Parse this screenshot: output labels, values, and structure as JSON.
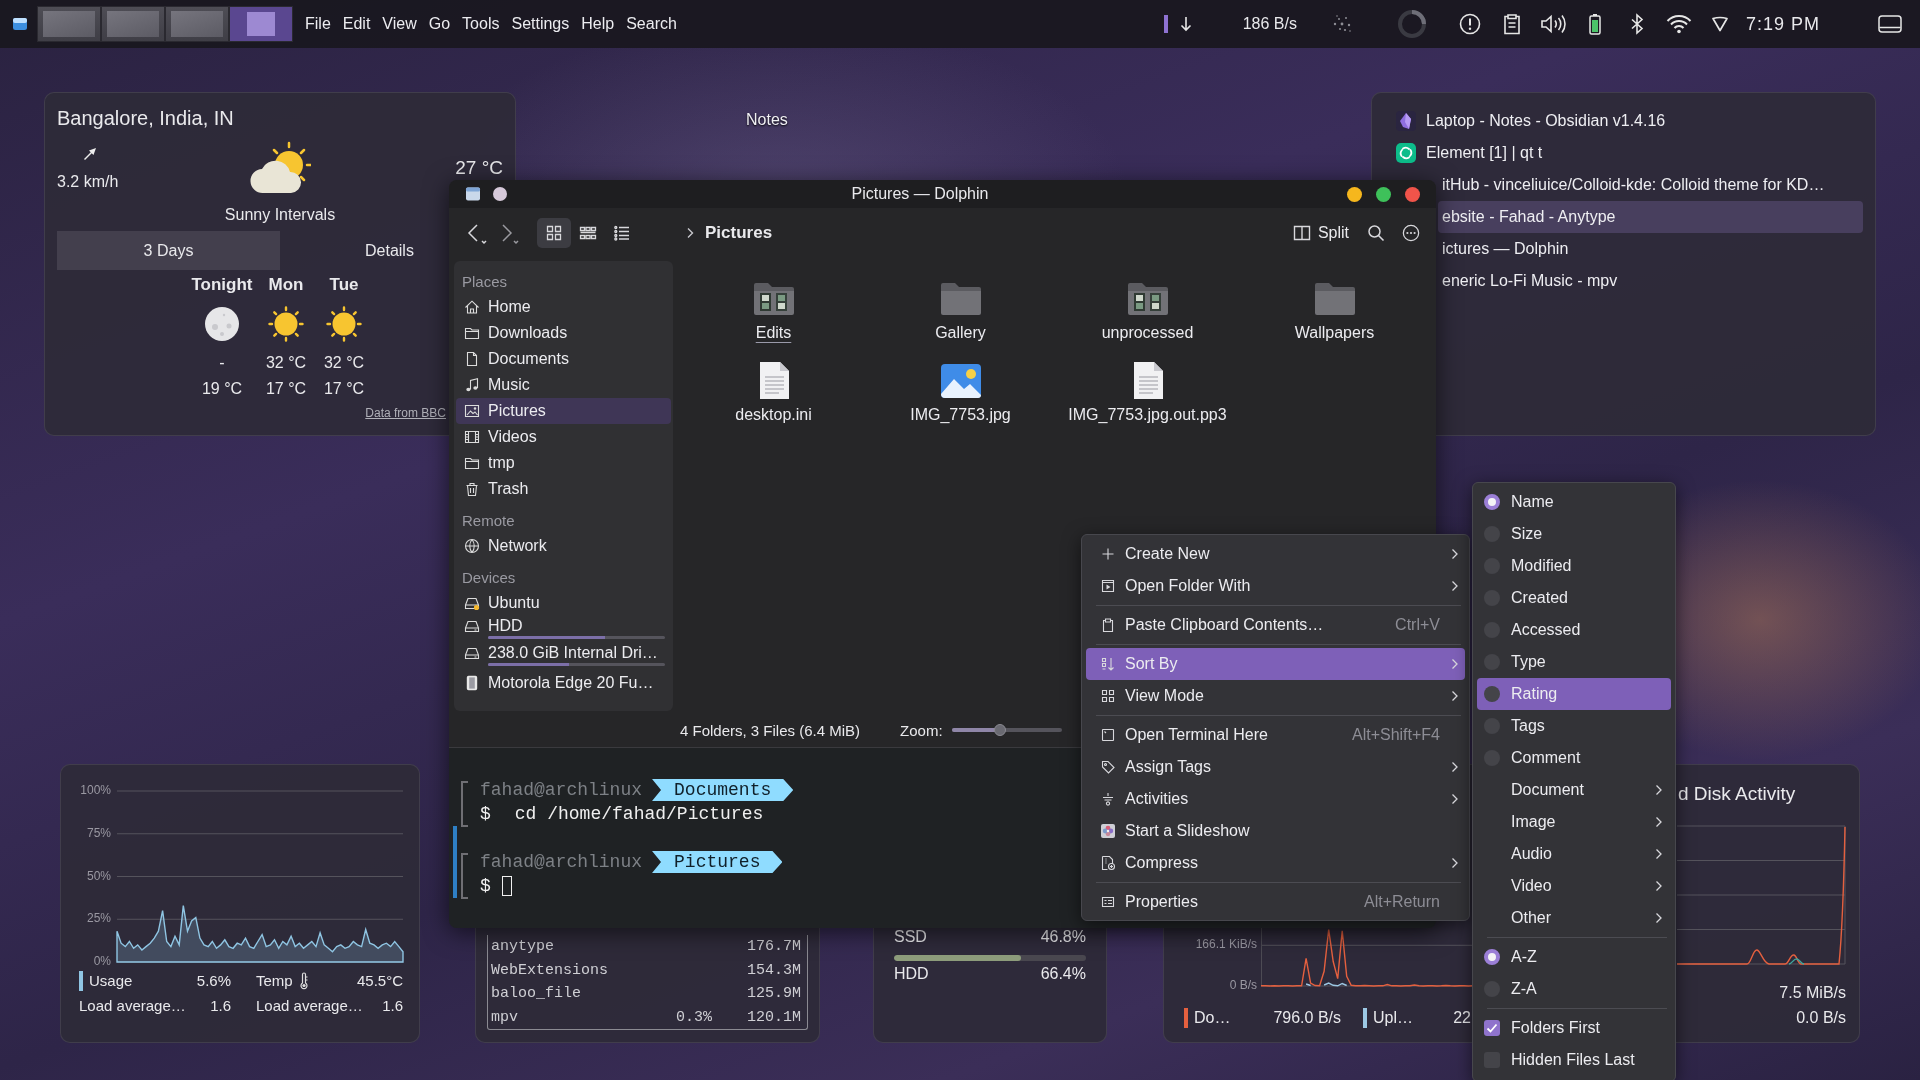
{
  "panel": {
    "pager": [
      {
        "selected": false
      },
      {
        "selected": false
      },
      {
        "selected": false
      },
      {
        "selected": true
      }
    ],
    "menu": [
      "File",
      "Edit",
      "View",
      "Go",
      "Tools",
      "Settings",
      "Help",
      "Search"
    ],
    "net_speed": "186 B/s",
    "clock": "7:19 PM"
  },
  "desktop_icons": [
    {
      "label": "Notes"
    }
  ],
  "weather": {
    "location": "Bangalore, India, IN",
    "wind": "3.2 km/h",
    "temperature": "27 °C",
    "condition": "Sunny Intervals",
    "tabs": [
      {
        "label": "3 Days",
        "selected": true
      },
      {
        "label": "Details",
        "selected": false
      }
    ],
    "forecast": [
      {
        "day": "Tonight",
        "kind": "night",
        "high": "-",
        "low": "19 °C"
      },
      {
        "day": "Mon",
        "kind": "day",
        "high": "32 °C",
        "low": "17 °C"
      },
      {
        "day": "Tue",
        "kind": "day",
        "high": "32 °C",
        "low": "17 °C"
      }
    ],
    "source": "Data from BBC"
  },
  "window_list": [
    {
      "title": "Laptop - Notes - Obsidian v1.4.16",
      "kind": "visible",
      "selected": false
    },
    {
      "title": "Element [1] | qt t",
      "kind": "visible",
      "selected": false
    },
    {
      "title": "itHub - vinceliuice/Colloid-kde: Colloid theme for KD…",
      "kind": "covered",
      "selected": false
    },
    {
      "title": "ebsite - Fahad - Anytype",
      "kind": "covered",
      "selected": true
    },
    {
      "title": "ictures — Dolphin",
      "kind": "covered",
      "selected": false
    },
    {
      "title": "eneric Lo-Fi Music - mpv",
      "kind": "covered",
      "selected": false
    }
  ],
  "dolphin": {
    "title": "Pictures — Dolphin",
    "view_modes": [
      {
        "selected": true
      },
      {
        "selected": false
      },
      {
        "selected": false
      }
    ],
    "breadcrumb": "Pictures",
    "split": "Split",
    "places": [
      {
        "heading": "Places",
        "items": [
          {
            "label": "Home",
            "kind": "home",
            "selected": false
          },
          {
            "label": "Downloads",
            "kind": "folder",
            "selected": false
          },
          {
            "label": "Documents",
            "kind": "document",
            "selected": false
          },
          {
            "label": "Music",
            "kind": "music",
            "selected": false
          },
          {
            "label": "Pictures",
            "kind": "image",
            "selected": true
          },
          {
            "label": "Videos",
            "kind": "video",
            "selected": false
          },
          {
            "label": "tmp",
            "kind": "folder",
            "selected": false
          },
          {
            "label": "Trash",
            "kind": "trash",
            "selected": false
          }
        ]
      },
      {
        "heading": "Remote",
        "items": [
          {
            "label": "Network",
            "kind": "network",
            "selected": false
          }
        ]
      },
      {
        "heading": "Devices",
        "items": [
          {
            "label": "Ubuntu",
            "kind": "system-drive",
            "selected": false
          },
          {
            "label": "HDD",
            "kind": "drive",
            "selected": false,
            "level": 0.66
          },
          {
            "label": "238.0 GiB Internal Dri…",
            "kind": "drive",
            "selected": false,
            "level": 0.46
          },
          {
            "label": "Motorola Edge 20 Fu…",
            "kind": "phone",
            "selected": false
          }
        ]
      }
    ],
    "files": [
      {
        "name": "Edits",
        "kind": "photo-folder",
        "focused": true
      },
      {
        "name": "Gallery",
        "kind": "folder",
        "focused": false
      },
      {
        "name": "unprocessed",
        "kind": "photo-folder",
        "focused": false
      },
      {
        "name": "Wallpapers",
        "kind": "folder",
        "focused": false
      },
      {
        "name": "desktop.ini",
        "kind": "text",
        "focused": false
      },
      {
        "name": "IMG_7753.jpg",
        "kind": "image",
        "focused": false
      },
      {
        "name": "IMG_7753.jpg.out.pp3",
        "kind": "text",
        "focused": false
      }
    ],
    "status": "4 Folders, 3 Files (6.4 MiB)",
    "zoom": {
      "label": "Zoom:",
      "level": 0.44
    },
    "terminal": [
      {
        "user": "fahad@archlinux",
        "directory": "Documents",
        "symbol": "$",
        "command": "cd /home/fahad/Pictures",
        "current": false,
        "cursor": false
      },
      {
        "user": "fahad@archlinux",
        "directory": "Pictures",
        "symbol": "$",
        "current": true,
        "cursor": true
      }
    ]
  },
  "context_menu": {
    "groups": [
      [
        {
          "label": "Create New",
          "submenu": true,
          "highlighted": false
        },
        {
          "label": "Open Folder With",
          "submenu": true,
          "highlighted": false
        }
      ],
      [
        {
          "label": "Paste Clipboard Contents…",
          "shortcut": "Ctrl+V",
          "submenu": false,
          "highlighted": false
        }
      ],
      [
        {
          "label": "Sort By",
          "submenu": true,
          "highlighted": true
        },
        {
          "label": "View Mode",
          "submenu": true,
          "highlighted": false
        }
      ],
      [
        {
          "label": "Open Terminal Here",
          "shortcut": "Alt+Shift+F4",
          "submenu": false,
          "highlighted": false
        },
        {
          "label": "Assign Tags",
          "submenu": true,
          "highlighted": false
        },
        {
          "label": "Activities",
          "submenu": true,
          "highlighted": false
        },
        {
          "label": "Start a Slideshow",
          "submenu": false,
          "highlighted": false
        },
        {
          "label": "Compress",
          "submenu": true,
          "highlighted": false
        }
      ],
      [
        {
          "label": "Properties",
          "shortcut": "Alt+Return",
          "submenu": false,
          "highlighted": false
        }
      ]
    ]
  },
  "sort_menu": {
    "groups": [
      [
        {
          "label": "Name",
          "kind": "radio",
          "checked": true,
          "highlighted": false
        },
        {
          "label": "Size",
          "kind": "radio",
          "checked": false,
          "highlighted": false
        },
        {
          "label": "Modified",
          "kind": "radio",
          "checked": false,
          "highlighted": false
        },
        {
          "label": "Created",
          "kind": "radio",
          "checked": false,
          "highlighted": false
        },
        {
          "label": "Accessed",
          "kind": "radio",
          "checked": false,
          "highlighted": false
        },
        {
          "label": "Type",
          "kind": "radio",
          "checked": false,
          "highlighted": false
        },
        {
          "label": "Rating",
          "kind": "radio",
          "checked": false,
          "highlighted": true
        },
        {
          "label": "Tags",
          "kind": "radio",
          "checked": false,
          "highlighted": false
        },
        {
          "label": "Comment",
          "kind": "radio",
          "checked": false,
          "highlighted": false
        },
        {
          "label": "Document",
          "kind": "submenu",
          "highlighted": false
        },
        {
          "label": "Image",
          "kind": "submenu",
          "highlighted": false
        },
        {
          "label": "Audio",
          "kind": "submenu",
          "highlighted": false
        },
        {
          "label": "Video",
          "kind": "submenu",
          "highlighted": false
        },
        {
          "label": "Other",
          "kind": "submenu",
          "highlighted": false
        }
      ],
      [
        {
          "label": "A-Z",
          "kind": "radio",
          "checked": true,
          "highlighted": false
        },
        {
          "label": "Z-A",
          "kind": "radio",
          "checked": false,
          "highlighted": false
        }
      ],
      [
        {
          "label": "Folders First",
          "kind": "checkbox",
          "checked": true,
          "highlighted": false
        },
        {
          "label": "Hidden Files Last",
          "kind": "checkbox",
          "checked": false,
          "highlighted": false
        }
      ]
    ]
  },
  "cpu_widget": {
    "chart_data": {
      "type": "area",
      "grid": true,
      "ylim": [
        0,
        100
      ],
      "yticks": [
        {
          "value": 0,
          "label": "0%"
        },
        {
          "value": 25,
          "label": "25%"
        },
        {
          "value": 50,
          "label": "50%"
        },
        {
          "value": 75,
          "label": "75%"
        },
        {
          "value": 100,
          "label": "100%"
        }
      ],
      "series": [
        {
          "name": "Usage",
          "color": "#8fc5e3",
          "values": [
            18,
            11,
            9,
            12,
            8,
            10,
            7,
            9,
            11,
            14,
            18,
            30,
            12,
            9,
            15,
            10,
            33,
            18,
            24,
            26,
            14,
            10,
            9,
            12,
            8,
            10,
            13,
            9,
            8,
            11,
            10,
            14,
            9,
            8,
            12,
            16,
            9,
            10,
            13,
            8,
            12,
            10,
            15,
            9,
            11,
            8,
            10,
            12,
            9,
            17,
            10,
            8,
            6,
            9,
            10,
            8,
            9,
            12,
            10,
            9,
            19,
            11,
            10,
            8,
            10,
            11,
            9,
            12,
            9,
            6
          ]
        }
      ]
    },
    "stats": [
      {
        "kind": "series",
        "value": "5.6%"
      },
      {
        "kind": "sensor",
        "label": "Temp",
        "value": "45.5°C"
      },
      {
        "kind": "plain",
        "label": "Load average…",
        "value": "1.6"
      },
      {
        "kind": "plain",
        "label": "Load average…",
        "value": "1.6"
      }
    ]
  },
  "process_widget": {
    "rows": [
      {
        "name": "anytype",
        "memory": "176.7M"
      },
      {
        "name": "WebExtensions",
        "memory": "154.3M"
      },
      {
        "name": "baloo_file",
        "memory": "125.9M"
      },
      {
        "name": "mpv",
        "cpu": "0.3%",
        "memory": "120.1M"
      }
    ]
  },
  "disk_widget": {
    "disks": [
      {
        "name": "SSD",
        "usage": "46.8%"
      },
      {
        "name": "HDD",
        "usage": "66.4%",
        "level": 0.664
      }
    ]
  },
  "activity_widget": {
    "network": {
      "chart_data": {
        "type": "line",
        "grid": true,
        "ylim": [
          0,
          255
        ],
        "yticks": [
          {
            "value": 0,
            "label": "0 B/s"
          },
          {
            "value": 166.1,
            "label": "166.1 KiB/s"
          }
        ],
        "series": [
          {
            "name": "Do…",
            "color": "#e5603f",
            "values": [
              1,
              1,
              0,
              1,
              0,
              1,
              1,
              0,
              1,
              1,
              113,
              12,
              2,
              1,
              60,
              230,
              100,
              30,
              225,
              40,
              3,
              1,
              1,
              2,
              1,
              0,
              1,
              1,
              6,
              1,
              1,
              0,
              1,
              1,
              4,
              1,
              0,
              1,
              1,
              0,
              1,
              2,
              1,
              0,
              1,
              1,
              0,
              1
            ]
          },
          {
            "name": "Upl…",
            "color": "#9cc8e4",
            "values": [
              null,
              null,
              null,
              null,
              null,
              null,
              null,
              null,
              null,
              null,
              8,
              2,
              null,
              null,
              4,
              12,
              3,
              1,
              10,
              2,
              null,
              null,
              null,
              null,
              null,
              null,
              null,
              null,
              null,
              null,
              null,
              null,
              null,
              null,
              null,
              null,
              null,
              null,
              null,
              null,
              null,
              null,
              null,
              null,
              null,
              null,
              null,
              null
            ]
          }
        ]
      },
      "readings": [
        "796.0 B/s",
        "22"
      ]
    },
    "disk": {
      "title": "d Disk Activity",
      "readings": [
        "7.5 MiB/s",
        "0.0 B/s"
      ]
    }
  }
}
